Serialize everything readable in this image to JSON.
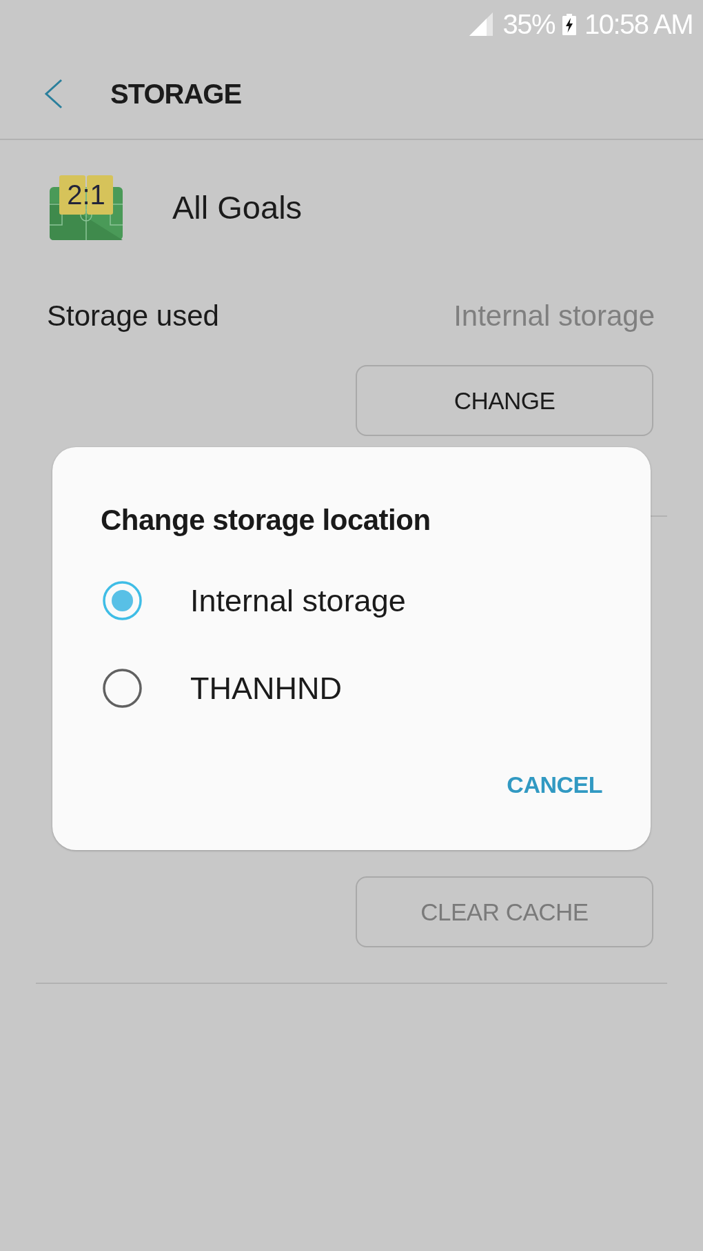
{
  "status_bar": {
    "battery": "35%",
    "charging": true,
    "time": "10:58 AM"
  },
  "header": {
    "title": "STORAGE"
  },
  "app": {
    "icon_text": "2:1",
    "name": "All Goals"
  },
  "storage": {
    "label": "Storage used",
    "value": "Internal storage",
    "change_button": "CHANGE"
  },
  "cache": {
    "clear_cache_button": "CLEAR CACHE",
    "disabled": true
  },
  "dialog": {
    "title": "Change storage location",
    "options": [
      {
        "label": "Internal storage",
        "selected": true
      },
      {
        "label": "THANHND",
        "selected": false
      }
    ],
    "cancel_button": "CANCEL"
  }
}
